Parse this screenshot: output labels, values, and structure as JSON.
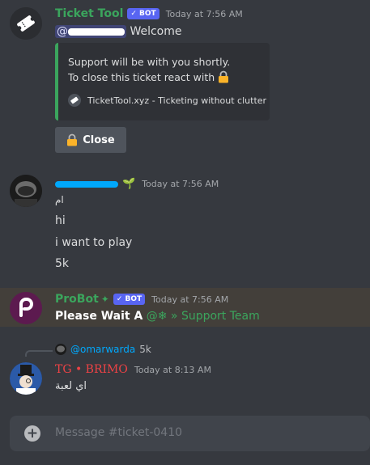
{
  "ticket_tool_message": {
    "username": "Ticket Tool",
    "bot_badge": "✓ BOT",
    "timestamp": "Today at 7:56 AM",
    "mention": "@",
    "welcome": "Welcome",
    "embed": {
      "line1": "Support will be with you shortly.",
      "line2": "To close this ticket react with",
      "footer": "TicketTool.xyz - Ticketing without clutter",
      "accent_color": "#3ba55d"
    },
    "close_button": {
      "label": "Close",
      "icon": "lock-icon"
    }
  },
  "user_message": {
    "timestamp": "Today at 7:56 AM",
    "lines": [
      "ام",
      "hi",
      "i want to play",
      "5k"
    ]
  },
  "probot_message": {
    "username": "ProBot",
    "bot_badge": "✓ BOT",
    "timestamp": "Today at 7:56 AM",
    "bold_text": "Please Wait A",
    "role_mention": "@❄ » Support Team"
  },
  "reply_message": {
    "reply_to_user": "@omarwarda",
    "reply_to_text": "5k",
    "username": "TG • BRIMO",
    "timestamp": "Today at 8:13 AM",
    "content": "اي لعبة"
  },
  "composer": {
    "placeholder": "Message #ticket-0410"
  },
  "colors": {
    "background": "#36393f",
    "ticket_tool_name": "#3ba55d",
    "probot_name": "#3ba55d",
    "brimo_name": "#ed4245",
    "bot_badge": "#5865f2"
  }
}
